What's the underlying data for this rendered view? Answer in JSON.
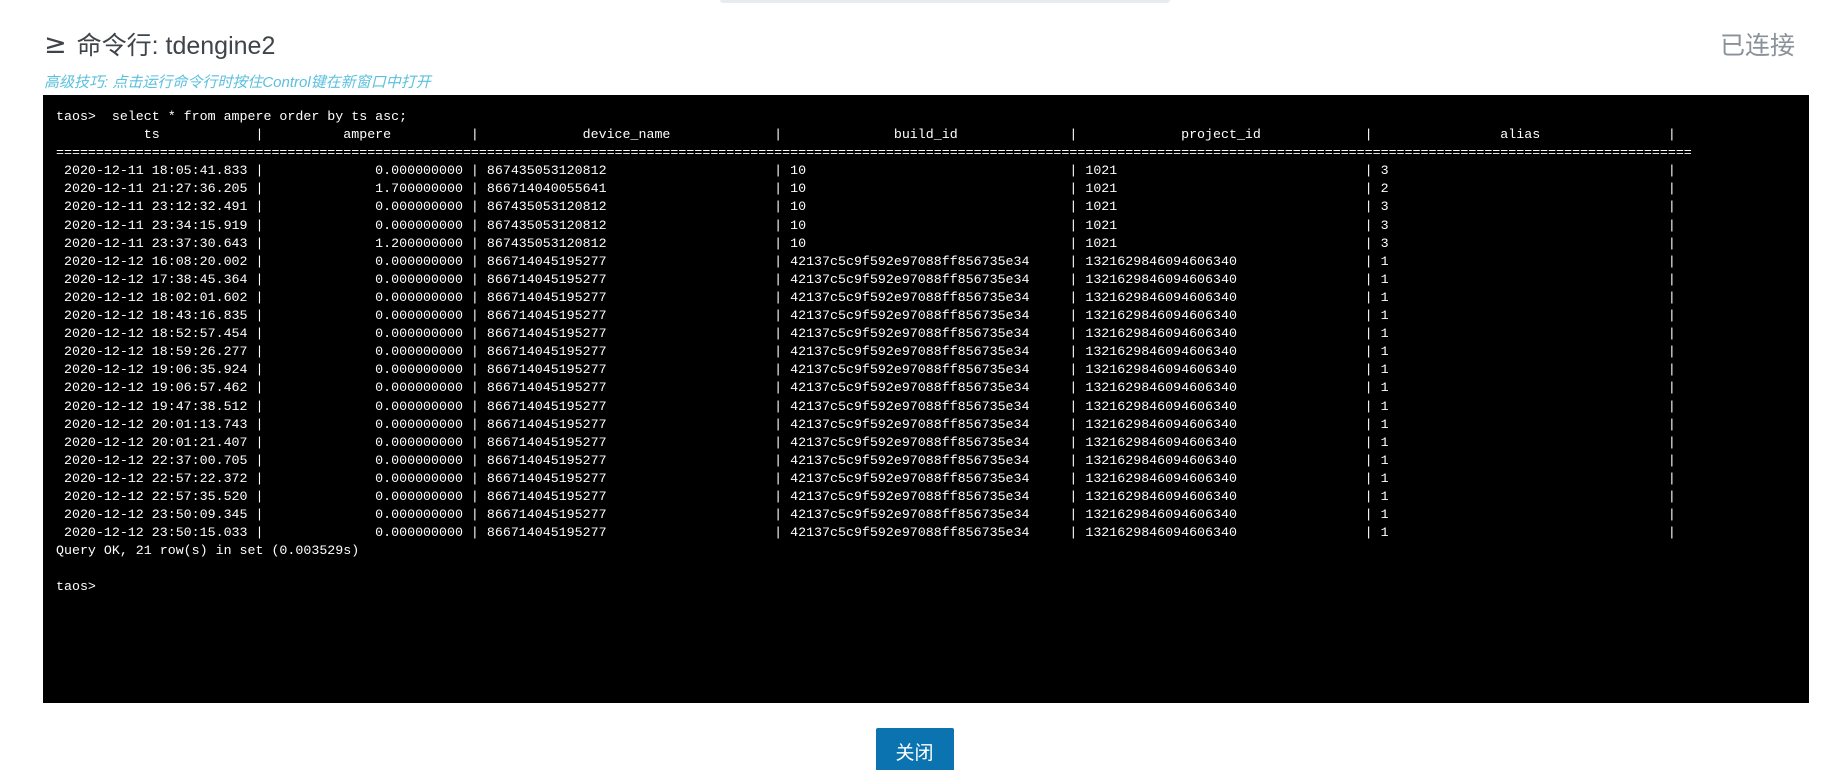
{
  "header": {
    "icon": "greater-than-or-equal-icon",
    "icon_glyph": "≥",
    "title": "命令行: tdengine2",
    "status": "已连接"
  },
  "tip": "高级技巧: 点击运行命令行时按住Control键在新窗口中打开",
  "terminal": {
    "lines": [
      "taos>  select * from ampere order by ts asc;",
      "           ts            |          ampere          |             device_name             |              build_id              |             project_id             |                alias                |",
      "=============================================================================================================================================================================================================",
      " 2020-12-11 18:05:41.833 |              0.000000000 | 867435053120812                     | 10                                 | 1021                               | 3                                   |",
      " 2020-12-11 21:27:36.205 |              1.700000000 | 866714040055641                     | 10                                 | 1021                               | 2                                   |",
      " 2020-12-11 23:12:32.491 |              0.000000000 | 867435053120812                     | 10                                 | 1021                               | 3                                   |",
      " 2020-12-11 23:34:15.919 |              0.000000000 | 867435053120812                     | 10                                 | 1021                               | 3                                   |",
      " 2020-12-11 23:37:30.643 |              1.200000000 | 867435053120812                     | 10                                 | 1021                               | 3                                   |",
      " 2020-12-12 16:08:20.002 |              0.000000000 | 866714045195277                     | 42137c5c9f592e97088ff856735e34     | 1321629846094606340                | 1                                   |",
      " 2020-12-12 17:38:45.364 |              0.000000000 | 866714045195277                     | 42137c5c9f592e97088ff856735e34     | 1321629846094606340                | 1                                   |",
      " 2020-12-12 18:02:01.602 |              0.000000000 | 866714045195277                     | 42137c5c9f592e97088ff856735e34     | 1321629846094606340                | 1                                   |",
      " 2020-12-12 18:43:16.835 |              0.000000000 | 866714045195277                     | 42137c5c9f592e97088ff856735e34     | 1321629846094606340                | 1                                   |",
      " 2020-12-12 18:52:57.454 |              0.000000000 | 866714045195277                     | 42137c5c9f592e97088ff856735e34     | 1321629846094606340                | 1                                   |",
      " 2020-12-12 18:59:26.277 |              0.000000000 | 866714045195277                     | 42137c5c9f592e97088ff856735e34     | 1321629846094606340                | 1                                   |",
      " 2020-12-12 19:06:35.924 |              0.000000000 | 866714045195277                     | 42137c5c9f592e97088ff856735e34     | 1321629846094606340                | 1                                   |",
      " 2020-12-12 19:06:57.462 |              0.000000000 | 866714045195277                     | 42137c5c9f592e97088ff856735e34     | 1321629846094606340                | 1                                   |",
      " 2020-12-12 19:47:38.512 |              0.000000000 | 866714045195277                     | 42137c5c9f592e97088ff856735e34     | 1321629846094606340                | 1                                   |",
      " 2020-12-12 20:01:13.743 |              0.000000000 | 866714045195277                     | 42137c5c9f592e97088ff856735e34     | 1321629846094606340                | 1                                   |",
      " 2020-12-12 20:01:21.407 |              0.000000000 | 866714045195277                     | 42137c5c9f592e97088ff856735e34     | 1321629846094606340                | 1                                   |",
      " 2020-12-12 22:37:00.705 |              0.000000000 | 866714045195277                     | 42137c5c9f592e97088ff856735e34     | 1321629846094606340                | 1                                   |",
      " 2020-12-12 22:57:22.372 |              0.000000000 | 866714045195277                     | 42137c5c9f592e97088ff856735e34     | 1321629846094606340                | 1                                   |",
      " 2020-12-12 22:57:35.520 |              0.000000000 | 866714045195277                     | 42137c5c9f592e97088ff856735e34     | 1321629846094606340                | 1                                   |",
      " 2020-12-12 23:50:09.345 |              0.000000000 | 866714045195277                     | 42137c5c9f592e97088ff856735e34     | 1321629846094606340                | 1                                   |",
      " 2020-12-12 23:50:15.033 |              0.000000000 | 866714045195277                     | 42137c5c9f592e97088ff856735e34     | 1321629846094606340                | 1                                   |",
      "Query OK, 21 row(s) in set (0.003529s)",
      "",
      "taos>"
    ]
  },
  "footer": {
    "close_label": "关闭"
  }
}
